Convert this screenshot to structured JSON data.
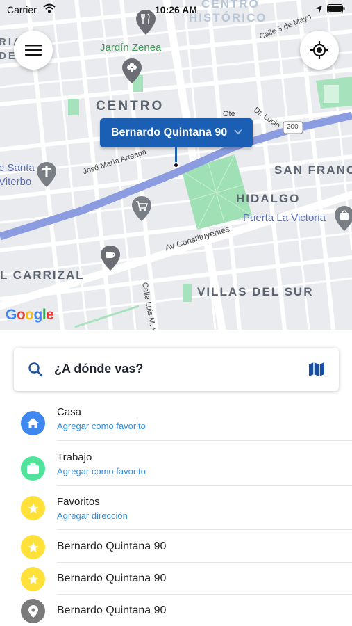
{
  "status_bar": {
    "carrier": "Carrier",
    "time": "10:26 AM"
  },
  "map": {
    "labels": {
      "centro_historico_1": "CENTRO",
      "centro_historico_2": "HISTÓRICO",
      "jardin_zenea": "Jardín Zenea",
      "calle_5_mayo": "Calle 5 de Mayo",
      "centro": "CENTRO",
      "ote": "Ote",
      "dr_lucio": "Dr. Lucio",
      "route_200": "200",
      "jose_maria_arteaga": "José María Arteaga",
      "santa_1": "e Santa",
      "santa_2": "Viterbo",
      "san_fran": "SAN FRANC",
      "hidalgo": "HIDALGO",
      "puerta_la_victoria": "Puerta La Victoria",
      "av_constituyentes": "Av Constituyentes",
      "carrizal": "L CARRIZAL",
      "calle_luis": "Calle Luis M. Ver",
      "villas_del_sur": "VILLAS DEL SUR",
      "ria": "RIA",
      "de": "DE"
    },
    "google_logo": "Google",
    "pin_label": "Bernardo Quintana 90"
  },
  "search": {
    "placeholder": "¿A dónde vas?"
  },
  "list": {
    "items": [
      {
        "title": "Casa",
        "subtitle": "Agregar como favorito",
        "icon": "home-icon",
        "color": "#3d87f0"
      },
      {
        "title": "Trabajo",
        "subtitle": "Agregar como favorito",
        "icon": "briefcase-icon",
        "color": "#4fe39b"
      },
      {
        "title": "Favoritos",
        "subtitle": "Agregar dirección",
        "icon": "star-icon",
        "color": "#ffe13a"
      },
      {
        "title": "Bernardo Quintana 90",
        "icon": "star-icon",
        "color": "#ffe13a"
      },
      {
        "title": "Bernardo Quintana 90",
        "icon": "star-icon",
        "color": "#ffe13a"
      },
      {
        "title": "Bernardo Quintana 90",
        "icon": "location-pin-icon",
        "color": "#7a7a7a"
      }
    ]
  },
  "colors": {
    "accent": "#1a5fb4",
    "link": "#2f8fe0",
    "route": "#8b9de0",
    "park": "#9fe0b5"
  }
}
